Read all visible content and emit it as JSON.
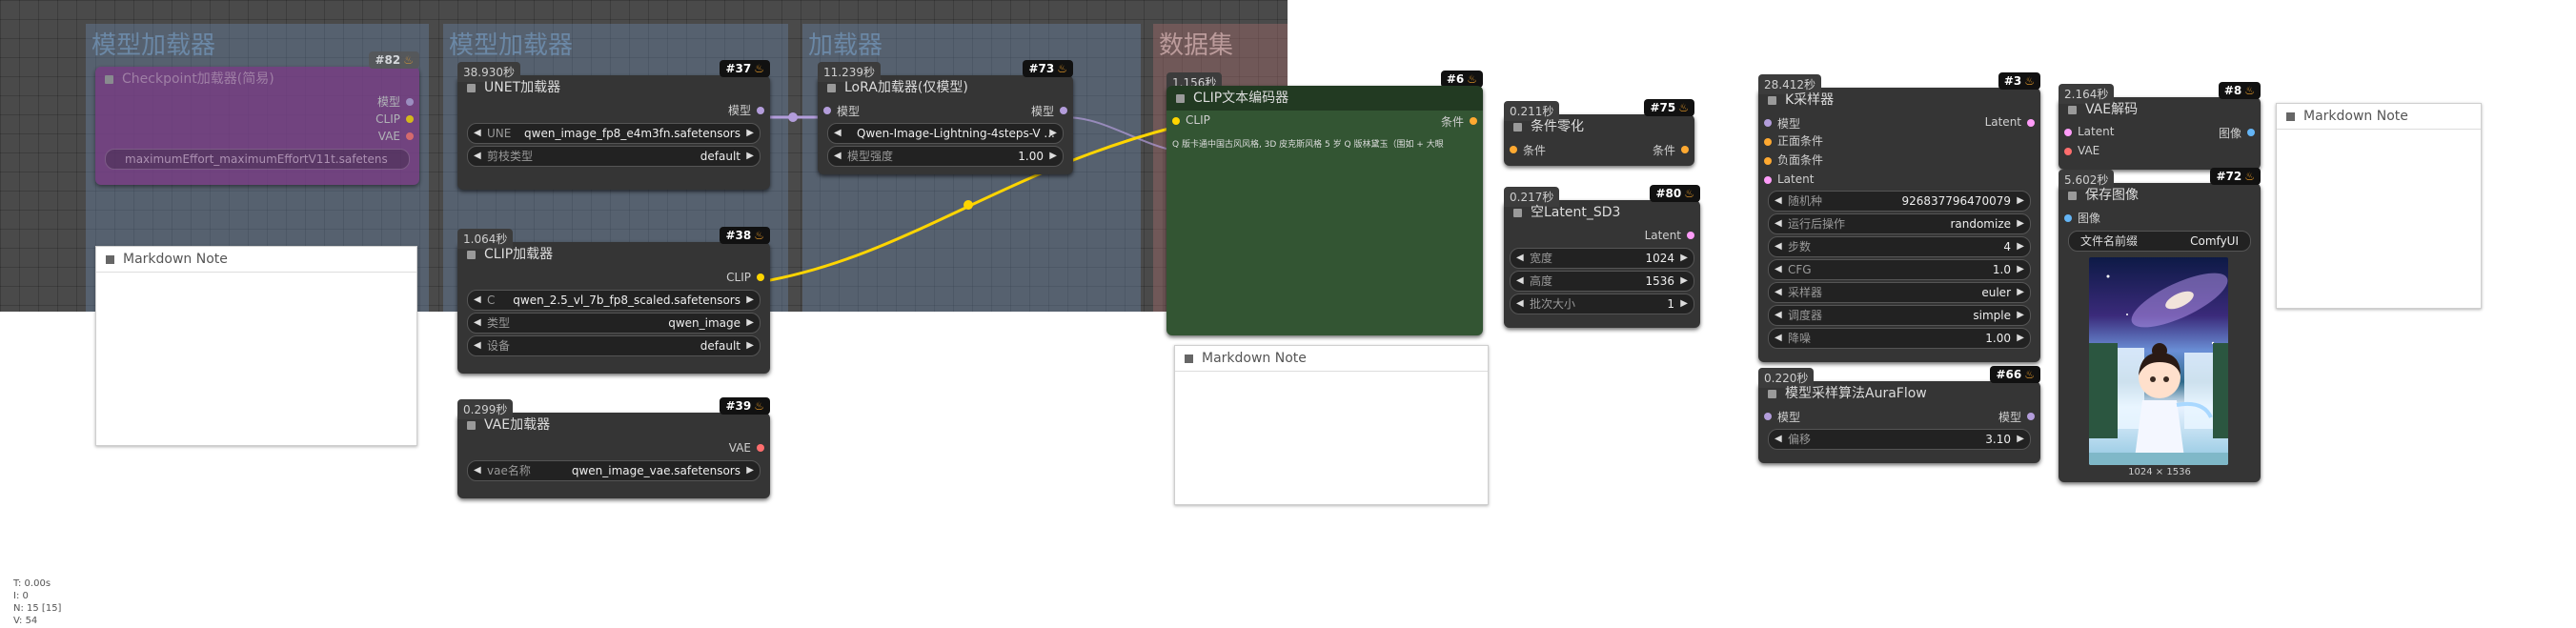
{
  "groups": [
    {
      "title": "模型加载器"
    },
    {
      "title": "模型加载器"
    },
    {
      "title": "加载器"
    },
    {
      "title": "数据集"
    }
  ],
  "nodes": {
    "checkpoint": {
      "id": "#82",
      "title": "Checkpoint加载器(简易)",
      "outputs": [
        "模型",
        "CLIP",
        "VAE"
      ],
      "widget": "maximumEffort_maximumEffortV11t.safetens"
    },
    "unet": {
      "time": "38.930秒",
      "id": "#37",
      "title": "UNET加载器",
      "output": "模型",
      "widgets": [
        {
          "name": "UNE",
          "value": "qwen_image_fp8_e4m3fn.safetensors"
        },
        {
          "name": "剪枝类型",
          "value": "default"
        }
      ]
    },
    "clip_loader": {
      "time": "1.064秒",
      "id": "#38",
      "title": "CLIP加载器",
      "output": "CLIP",
      "widgets": [
        {
          "name": "C",
          "value": "qwen_2.5_vl_7b_fp8_scaled.safetensors"
        },
        {
          "name": "类型",
          "value": "qwen_image"
        },
        {
          "name": "设备",
          "value": "default"
        }
      ]
    },
    "vae_loader": {
      "time": "0.299秒",
      "id": "#39",
      "title": "VAE加载器",
      "output": "VAE",
      "widgets": [
        {
          "name": "vae名称",
          "value": "qwen_image_vae.safetensors"
        }
      ]
    },
    "lora": {
      "time": "11.239秒",
      "id": "#73",
      "title": "LoRA加载器(仅模型)",
      "input": "模型",
      "output": "模型",
      "widgets": [
        {
          "name": "",
          "value": "Qwen-Image-Lightning-4steps-V ..."
        },
        {
          "name": "模型强度",
          "value": "1.00"
        }
      ]
    },
    "clip_text": {
      "time": "1.156秒",
      "id": "#6",
      "title": "CLIP文本编码器",
      "input": "CLIP",
      "output": "条件",
      "text": "Q 版卡通中国古风风格, 3D 皮克斯风格 5 岁 Q 版林黛玉（围如 + 大眼"
    },
    "cond_zero": {
      "time": "0.211秒",
      "id": "#75",
      "title": "条件零化",
      "input": "条件",
      "output": "条件"
    },
    "empty_latent": {
      "time": "0.217秒",
      "id": "#80",
      "title": "空Latent_SD3",
      "output": "Latent",
      "widgets": [
        {
          "name": "宽度",
          "value": "1024"
        },
        {
          "name": "高度",
          "value": "1536"
        },
        {
          "name": "批次大小",
          "value": "1"
        }
      ]
    },
    "ksampler": {
      "time": "28.412秒",
      "id": "#3",
      "title": "K采样器",
      "inputs": [
        "模型",
        "正面条件",
        "负面条件",
        "Latent"
      ],
      "output": "Latent",
      "widgets": [
        {
          "name": "随机种",
          "value": "926837796470079"
        },
        {
          "name": "运行后操作",
          "value": "randomize"
        },
        {
          "name": "步数",
          "value": "4"
        },
        {
          "name": "CFG",
          "value": "1.0"
        },
        {
          "name": "采样器",
          "value": "euler"
        },
        {
          "name": "调度器",
          "value": "simple"
        },
        {
          "name": "降噪",
          "value": "1.00"
        }
      ]
    },
    "aura": {
      "time": "0.220秒",
      "id": "#66",
      "title": "模型采样算法AuraFlow",
      "input": "模型",
      "output": "模型",
      "widgets": [
        {
          "name": "偏移",
          "value": "3.10"
        }
      ]
    },
    "vae_decode": {
      "time": "2.164秒",
      "id": "#8",
      "title": "VAE解码",
      "inputs": [
        "Latent",
        "VAE"
      ],
      "output": "图像"
    },
    "save_image": {
      "time": "5.602秒",
      "id": "#72",
      "title": "保存图像",
      "input": "图像",
      "prefix_name": "文件名前缀",
      "prefix_value": "ComfyUI",
      "image_size": "1024 × 1536"
    }
  },
  "notes": [
    {
      "title": "Markdown Note"
    },
    {
      "title": "Markdown Note"
    },
    {
      "title": "Markdown Note"
    }
  ],
  "status": {
    "t": "T: 0.00s",
    "i": "I: 0",
    "n": "N: 15 [15]",
    "v": "V: 54"
  },
  "colors": {
    "model": "#b39ddb",
    "clip": "#ffd500",
    "conditioning": "#ffa931",
    "latent": "#ff9cf9",
    "vae": "#ff6e6e",
    "image": "#64b5f6",
    "clip_text_node": "#335533",
    "checkpoint_node": "#7a3a85"
  }
}
